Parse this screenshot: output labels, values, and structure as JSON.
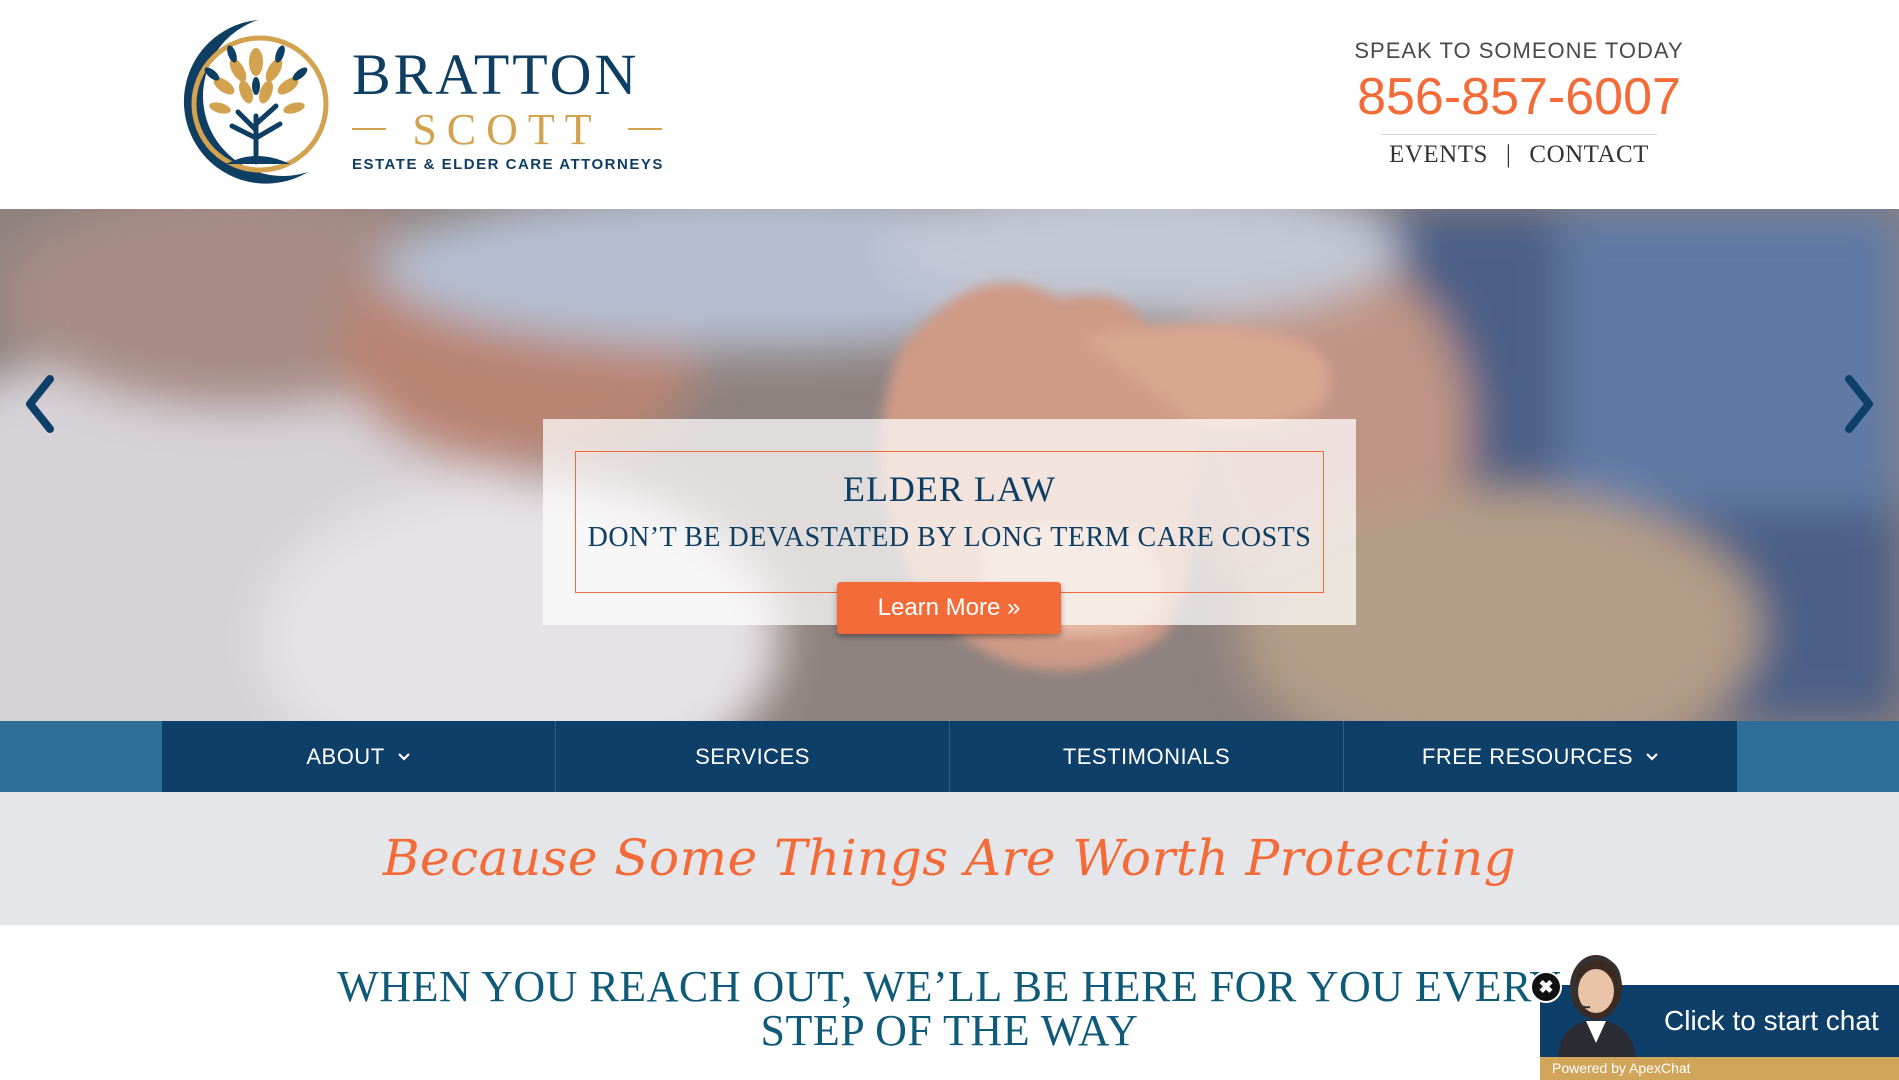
{
  "logo": {
    "name": "BRATTON",
    "name2": "SCOTT",
    "tagline": "ESTATE & ELDER CARE ATTORNEYS",
    "icon": "tree-of-life-icon"
  },
  "contact": {
    "speak_label": "SPEAK TO SOMEONE TODAY",
    "phone": "856-857-6007",
    "links": [
      "EVENTS",
      "CONTACT"
    ],
    "separator": "|"
  },
  "hero": {
    "title": "ELDER LAW",
    "subtitle": "DON’T BE DEVASTATED BY LONG TERM CARE COSTS",
    "button": "Learn More »",
    "prev_icon": "chevron-left-icon",
    "next_icon": "chevron-right-icon"
  },
  "nav": {
    "items": [
      {
        "label": "ABOUT",
        "dropdown": true
      },
      {
        "label": "SERVICES",
        "dropdown": false
      },
      {
        "label": "TESTIMONIALS",
        "dropdown": false
      },
      {
        "label": "FREE RESOURCES",
        "dropdown": true
      }
    ]
  },
  "tagline": "Because Some Things Are Worth Protecting",
  "headline": {
    "line1": "WHEN YOU REACH OUT, WE’LL BE HERE FOR YOU EVERY",
    "line2": "STEP OF THE WAY"
  },
  "chat": {
    "label": "Click to start chat",
    "powered": "Powered by ApexChat",
    "close": "✖"
  },
  "colors": {
    "navy": "#0e3f68",
    "orange": "#f26b38",
    "gold": "#d2a24f",
    "teal": "#2f6e96",
    "band": "#e4e6e9"
  }
}
